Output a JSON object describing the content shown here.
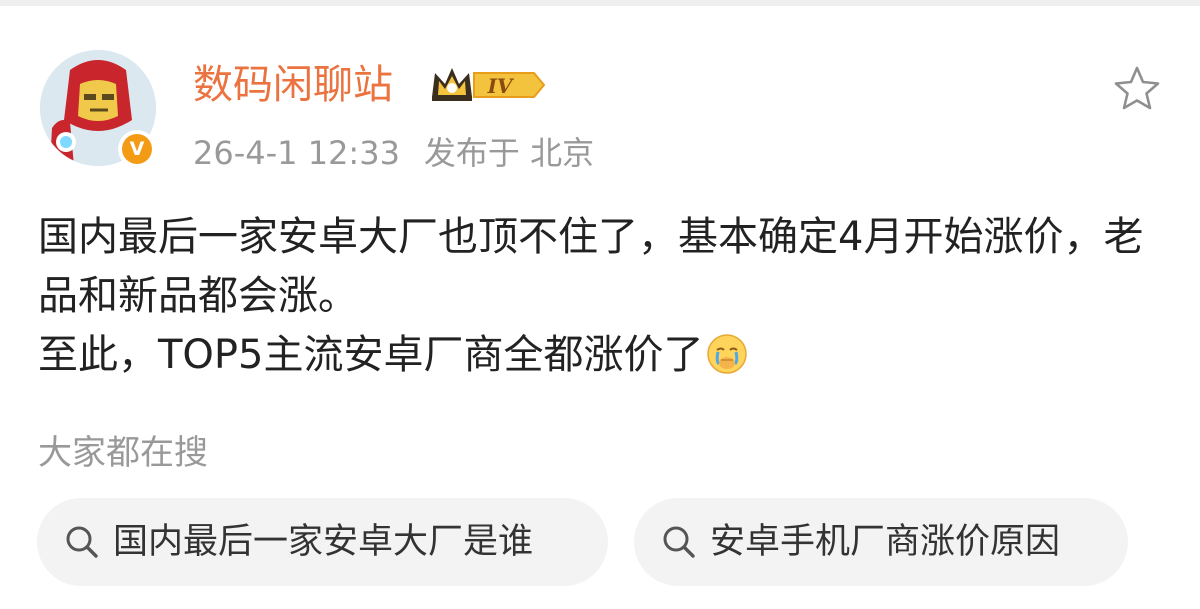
{
  "post": {
    "author": {
      "name": "数码闲聊站",
      "level_badge": "IV",
      "verified_mark": "V",
      "avatar_icon": "iron-man-avatar-icon"
    },
    "meta": {
      "timestamp": "26-4-1 12:33",
      "location": "发布于 北京"
    },
    "body": {
      "line1": "国内最后一家安卓大厂也顶不住了，基本确定4月开始涨价，老品和新品都会涨。",
      "line2": "至此，TOP5主流安卓厂商全都涨价了"
    },
    "icons": [
      "star-icon",
      "crying-face-emoji-icon",
      "search-icon",
      "crown-icon"
    ]
  },
  "trending": {
    "heading": "大家都在搜",
    "chips": [
      {
        "label": "国内最后一家安卓大厂是谁"
      },
      {
        "label": "安卓手机厂商涨价原因"
      }
    ]
  },
  "colors": {
    "username": "#eb7340",
    "verified": "#f49b16",
    "meta_text": "#999999",
    "body_text": "#222222",
    "chip_background": "#f3f3f3"
  }
}
